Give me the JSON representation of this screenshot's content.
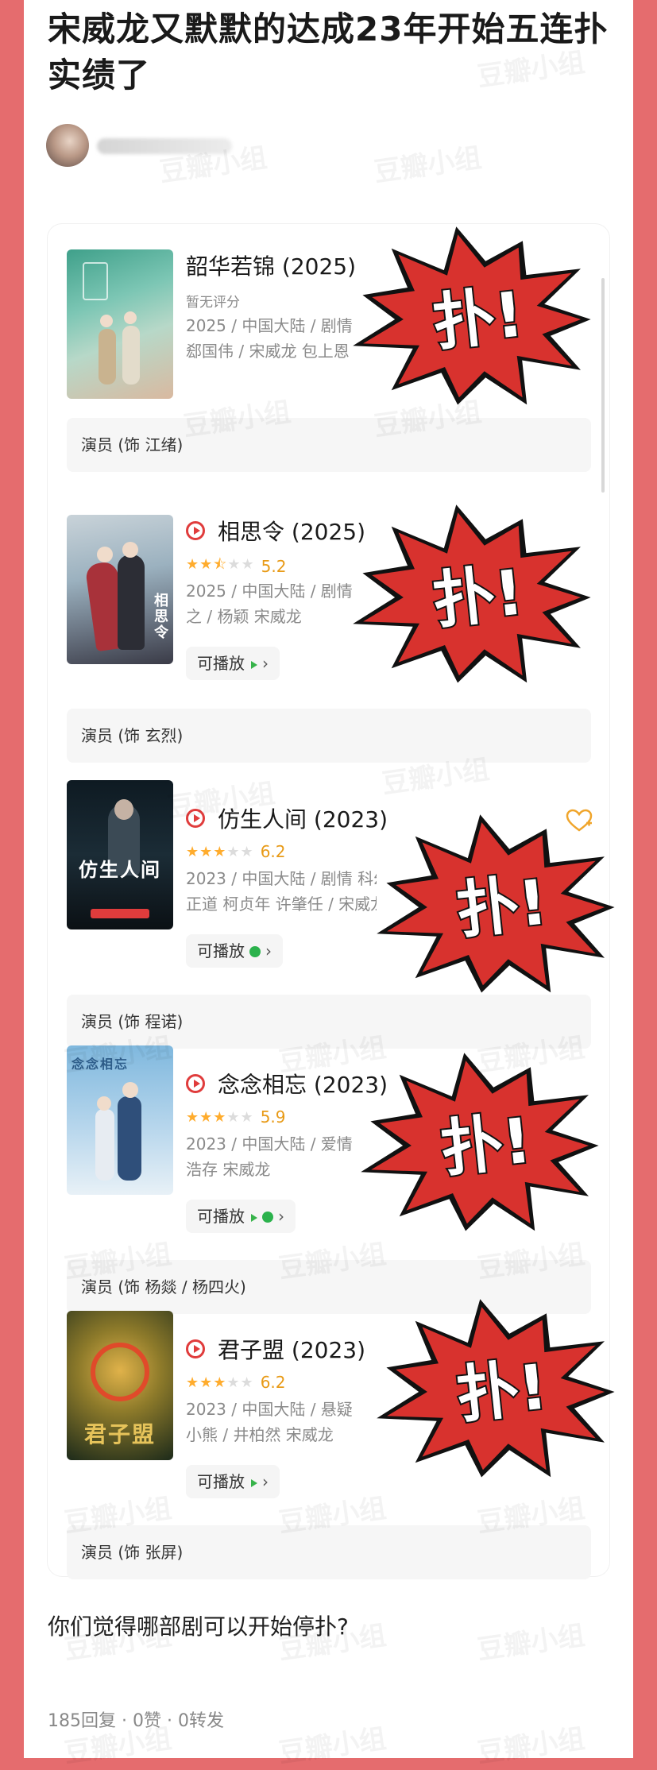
{
  "post": {
    "title": "宋威龙又默默的达成23年开始五连扑实绩了",
    "question": "你们觉得哪部剧可以开始停扑?",
    "stats": "185回复 · 0赞 · 0转发"
  },
  "stamp_text": "扑!",
  "watermark_text": "豆瓣小组",
  "items": [
    {
      "title": "韶华若锦 (2025)",
      "rating_text": "暂无评分",
      "meta1": "2025 / 中国大陆 / 剧情",
      "meta2": "郄国伟 / 宋威龙 包上恩",
      "role": "演员 (饰 江绪)",
      "poster_text": "",
      "stars": 0
    },
    {
      "title": "相思令 (2025)",
      "score": "5.2",
      "meta1": "2025 / 中国大陆 / 剧情",
      "meta2": "之 / 杨颖 宋威龙",
      "play_label": "可播放",
      "role": "演员 (饰 玄烈)",
      "poster_text": "相思令",
      "stars": 2.5
    },
    {
      "title": "仿生人间 (2023)",
      "score": "6.2",
      "meta1": "2023 / 中国大陆 / 剧情 科幻",
      "meta2": "正道 柯贞年 许肇任 / 宋威龙",
      "play_label": "可播放",
      "role": "演员 (饰 程诺)",
      "poster_text": "仿生人间",
      "stars": 3
    },
    {
      "title": "念念相忘 (2023)",
      "score": "5.9",
      "meta1": "2023 / 中国大陆 / 爱情",
      "meta2": "浩存 宋威龙",
      "play_label": "可播放",
      "role": "演员 (饰 杨燚 / 杨四火)",
      "poster_text": "念念相忘",
      "stars": 3
    },
    {
      "title": "君子盟 (2023)",
      "score": "6.2",
      "meta1": "2023 / 中国大陆 / 悬疑",
      "meta2": "小熊 / 井柏然 宋威龙",
      "play_label": "可播放",
      "role": "演员 (饰 张屏)",
      "poster_text": "君子盟",
      "stars": 3
    }
  ]
}
